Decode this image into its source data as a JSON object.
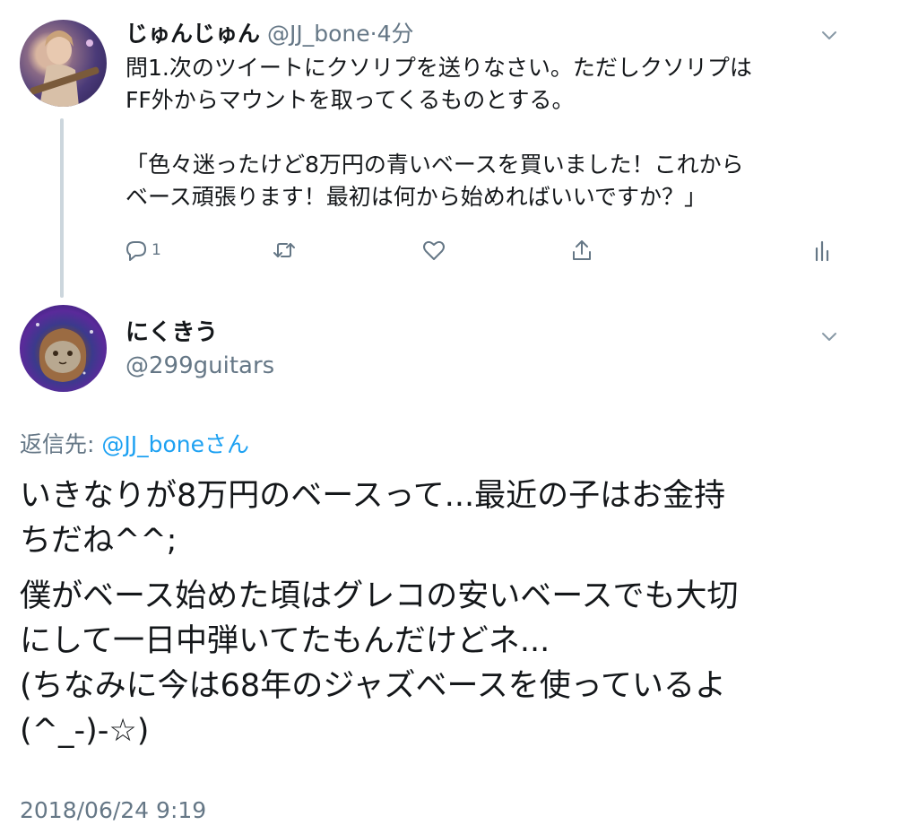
{
  "tweet1": {
    "display_name": "じゅんじゅん",
    "handle": "@JJ_bone",
    "separator": "·",
    "time": "4分",
    "text_line1": "問1.次のツイートにクソリプを送りなさい。ただしクソリプは",
    "text_line2": "FF外からマウントを取ってくるものとする。",
    "quote_line1": "「色々迷ったけど8万円の青いベースを買いました！これから",
    "quote_line2": "ベース頑張ります！最初は何から始めればいいですか？」",
    "reply_count": "1",
    "icons": [
      "reply-icon",
      "retweet-icon",
      "like-icon",
      "share-icon",
      "analytics-icon",
      "chevron-down-icon"
    ]
  },
  "tweet2": {
    "display_name": "にくきう",
    "handle": "@299guitars",
    "replying_label": "返信先: ",
    "replying_mention": "@JJ_boneさん",
    "paragraph1_line1": "いきなりが8万円のベースって...最近の子はお金持",
    "paragraph1_line2": "ちだね^^;",
    "paragraph2_line1": "僕がベース始めた頃はグレコの安いベースでも大切",
    "paragraph2_line2": "にして一日中弾いてたもんだけどネ...",
    "paragraph2_line3": "(ちなみに今は68年のジャズベースを使っているよ",
    "paragraph2_line4": "(^_-)-☆)",
    "timestamp": "2018/06/24 9:19"
  },
  "colors": {
    "text_primary": "#14171a",
    "text_secondary": "#657786",
    "link": "#1da1f2",
    "thread_line": "#ccd6dd"
  }
}
